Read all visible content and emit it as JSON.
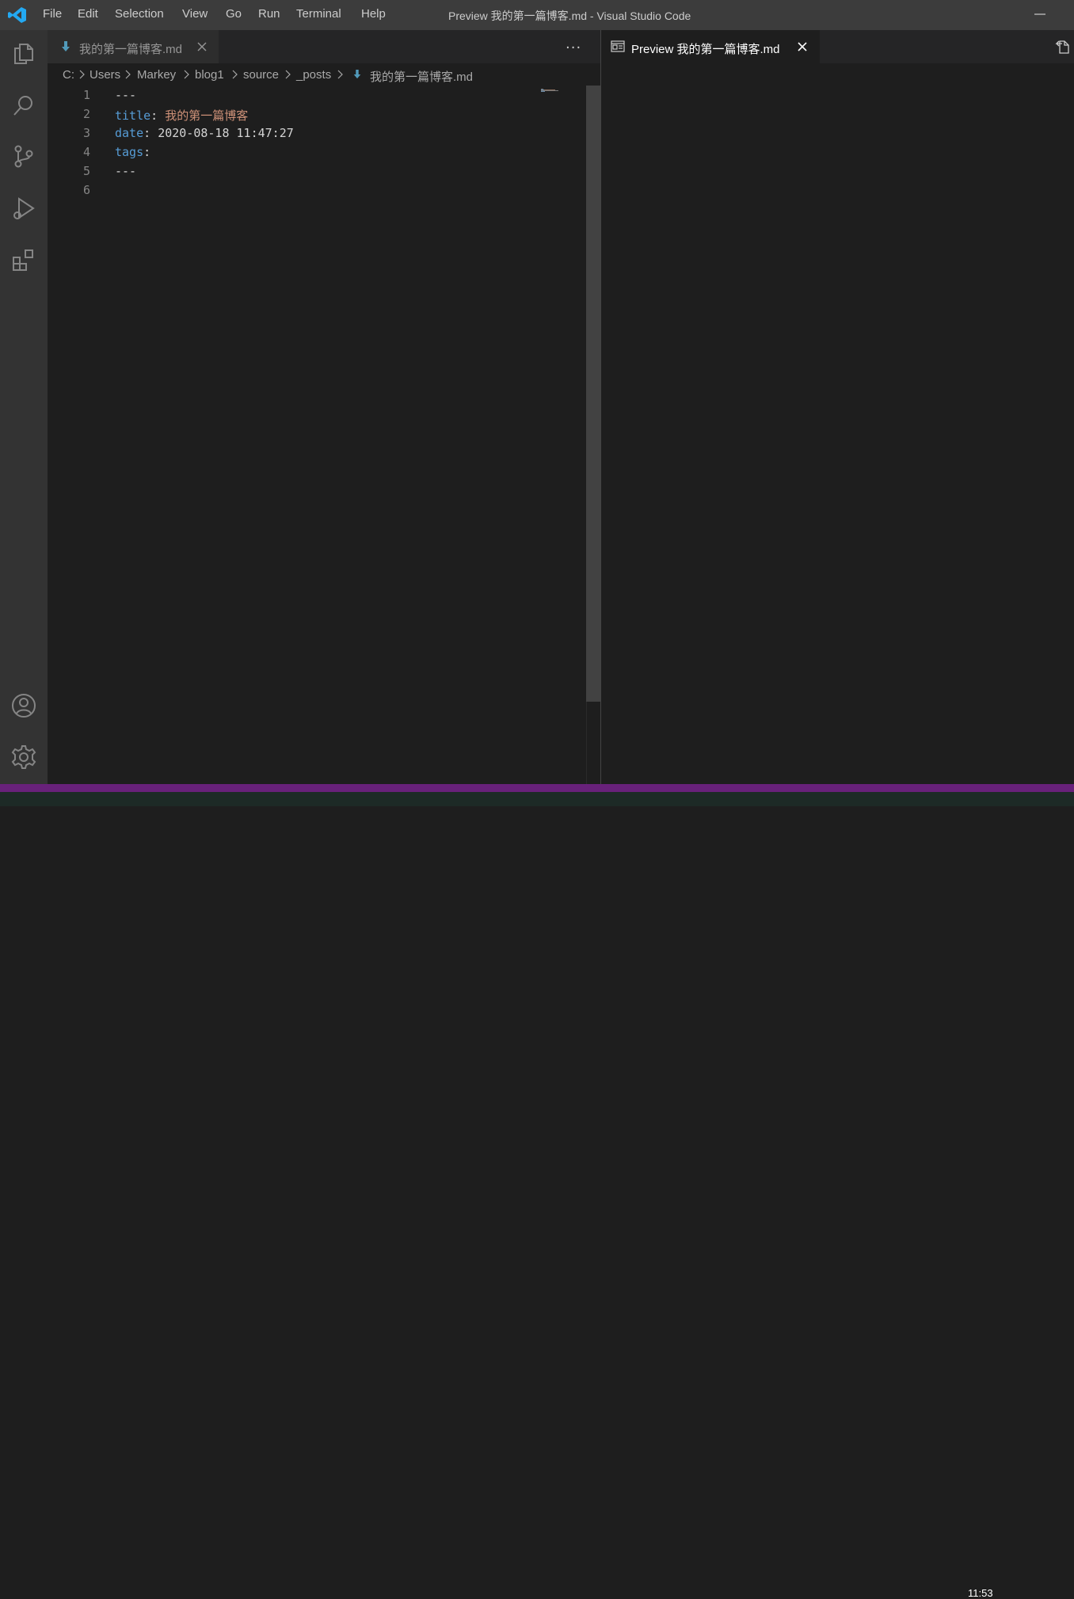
{
  "titlebar": {
    "menu": [
      "File",
      "Edit",
      "Selection",
      "View",
      "Go",
      "Run",
      "Terminal",
      "Help"
    ],
    "window_title": "Preview 我的第一篇博客.md - Visual Studio Code",
    "logo_icon": "vscode-logo-icon",
    "minimize_icon": "minimize-icon"
  },
  "activitybar": {
    "top_items": [
      "explorer-icon",
      "search-icon",
      "source-control-icon",
      "run-debug-icon",
      "extensions-icon"
    ],
    "bottom_items": [
      "account-icon",
      "gear-icon"
    ]
  },
  "editor": {
    "tab": {
      "label": "我的第一篇博客.md",
      "icon": "markdown-file-icon"
    },
    "more_actions": "···",
    "breadcrumb": [
      "C:",
      "Users",
      "Markey",
      "blog1",
      "source",
      "_posts",
      "我的第一篇博客.md"
    ],
    "line_numbers": [
      "1",
      "2",
      "3",
      "4",
      "5",
      "6"
    ],
    "lines": [
      {
        "text": "---"
      },
      {
        "key": "title",
        "punct": ": ",
        "value": "我的第一篇博客"
      },
      {
        "key": "date",
        "punct": ": ",
        "value": "2020-08-18 11:47:27"
      },
      {
        "key": "tags",
        "punct": ":"
      },
      {
        "text": "---"
      },
      {
        "text": ""
      }
    ]
  },
  "preview": {
    "tab": {
      "label": "Preview 我的第一篇博客.md",
      "icon": "preview-icon"
    },
    "open_source_icon": "open-source-icon"
  },
  "taskbar": {
    "clock": "11:53"
  },
  "colors": {
    "statusbar": "#68217a",
    "keyword": "#569cd6",
    "string": "#ce9178",
    "accent": "#23a9f2"
  }
}
